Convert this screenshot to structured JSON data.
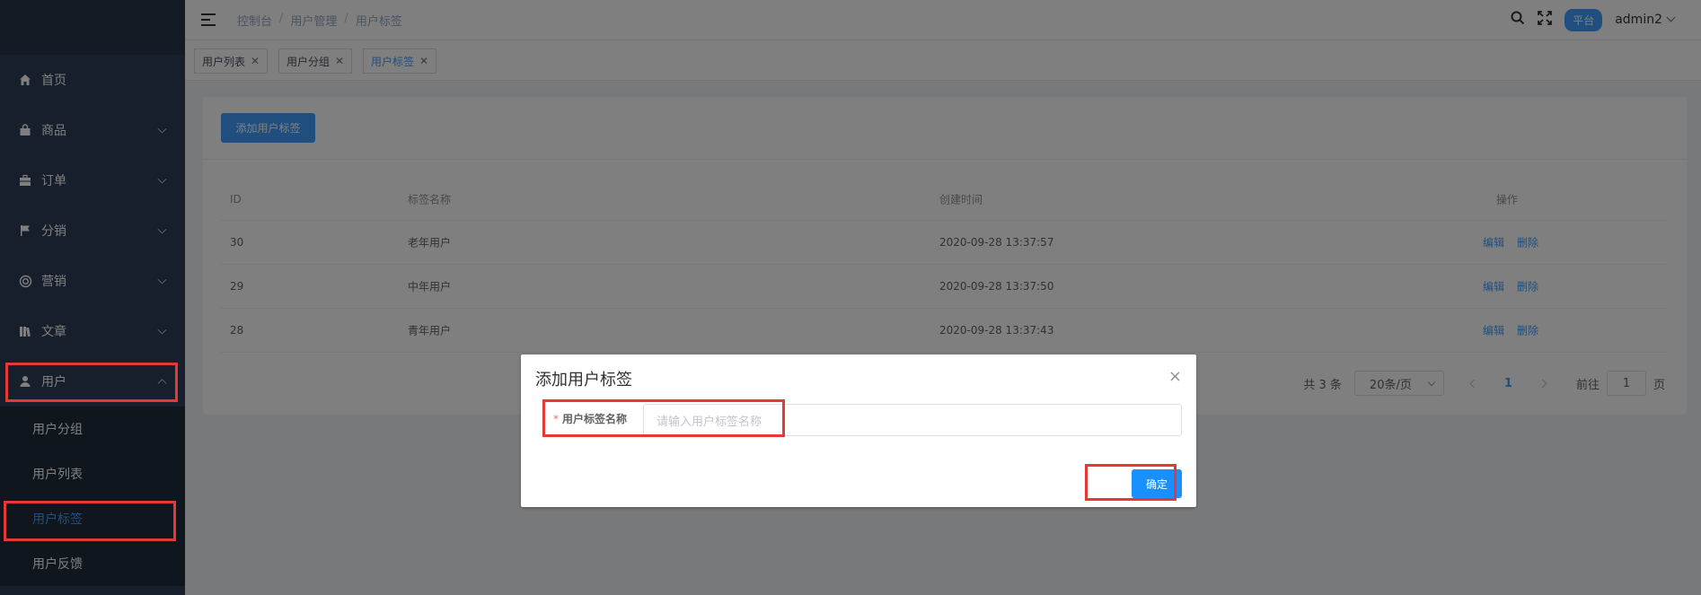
{
  "topbar": {
    "breadcrumb": [
      "控制台",
      "用户管理",
      "用户标签"
    ],
    "badge": "平台",
    "user": "admin2"
  },
  "sidebar": {
    "items": [
      {
        "label": "首页",
        "icon": "home-icon"
      },
      {
        "label": "商品",
        "icon": "bag-icon"
      },
      {
        "label": "订单",
        "icon": "briefcase-icon"
      },
      {
        "label": "分销",
        "icon": "flag-icon"
      },
      {
        "label": "营销",
        "icon": "lifebuoy-icon"
      },
      {
        "label": "文章",
        "icon": "books-icon"
      },
      {
        "label": "用户",
        "icon": "user-icon"
      }
    ],
    "user_sub": [
      "用户分组",
      "用户列表",
      "用户标签",
      "用户反馈"
    ]
  },
  "tags": [
    "用户列表",
    "用户分组",
    "用户标签"
  ],
  "card": {
    "add_label": "添加用户标签",
    "columns": [
      "ID",
      "标签名称",
      "创建时间",
      "操作"
    ],
    "rows": [
      {
        "id": "30",
        "name": "老年用户",
        "time": "2020-09-28 13:37:57"
      },
      {
        "id": "29",
        "name": "中年用户",
        "time": "2020-09-28 13:37:50"
      },
      {
        "id": "28",
        "name": "青年用户",
        "time": "2020-09-28 13:37:43"
      }
    ],
    "edit_label": "编辑",
    "delete_label": "删除",
    "pager": {
      "total": "共 3 条",
      "size": "20条/页",
      "page": "1",
      "goto_prefix": "前往",
      "goto_value": "1",
      "goto_suffix": "页"
    }
  },
  "dialog": {
    "title": "添加用户标签",
    "close": "×",
    "field_required": "*",
    "field_label": "用户标签名称",
    "field_placeholder": "请输入用户标签名称",
    "ok_label": "确定"
  },
  "colors": {
    "accent": "#409eff",
    "sidebar": "#2c3e57",
    "highlight": "#e53935"
  }
}
